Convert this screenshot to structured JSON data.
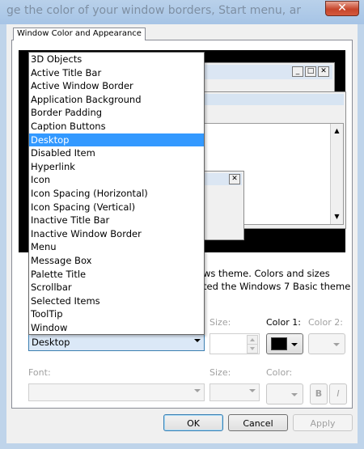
{
  "window": {
    "title": "ge the color of your window borders, Start menu, ar",
    "close_glyph": "✕"
  },
  "tab": {
    "label": "Window Color and Appearance"
  },
  "preview": {
    "min_glyph": "_",
    "max_glyph": "□",
    "close_glyph": "✕",
    "scroll_up": "▲",
    "scroll_down": "▼"
  },
  "description": {
    "line1": "ws theme.  Colors and sizes",
    "line2": "ted the Windows 7 Basic theme"
  },
  "item": {
    "selected": "Desktop",
    "options": [
      "3D Objects",
      "Active Title Bar",
      "Active Window Border",
      "Application Background",
      "Border Padding",
      "Caption Buttons",
      "Desktop",
      "Disabled Item",
      "Hyperlink",
      "Icon",
      "Icon Spacing (Horizontal)",
      "Icon Spacing (Vertical)",
      "Inactive Title Bar",
      "Inactive Window Border",
      "Menu",
      "Message Box",
      "Palette Title",
      "Scrollbar",
      "Selected Items",
      "ToolTip",
      "Window"
    ]
  },
  "labels": {
    "size": "Size:",
    "color1": "Color 1:",
    "color2": "Color 2:",
    "font": "Font:",
    "font_size": "Size:",
    "font_color": "Color:"
  },
  "format": {
    "bold": "B",
    "italic": "I"
  },
  "colors": {
    "color1": "#000000",
    "selection": "#3399ff"
  },
  "buttons": {
    "ok": "OK",
    "cancel": "Cancel",
    "apply": "Apply"
  }
}
